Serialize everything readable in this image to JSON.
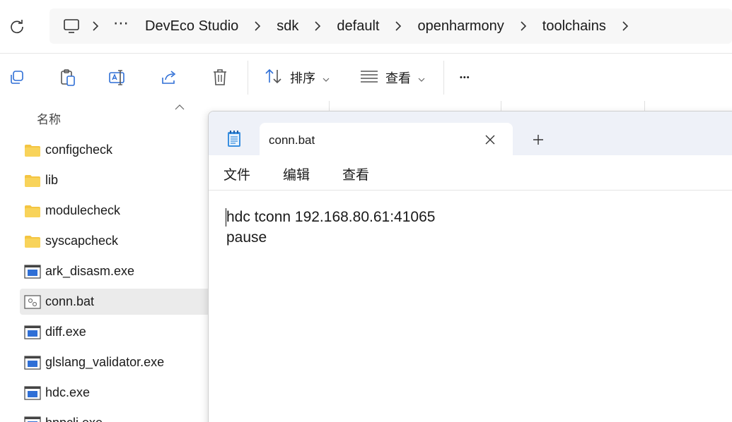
{
  "address_bar": {
    "ellipsis": "⋯",
    "breadcrumbs": [
      "DevEco Studio",
      "sdk",
      "default",
      "openharmony",
      "toolchains"
    ]
  },
  "toolbar": {
    "sort_label": "排序",
    "view_label": "查看",
    "more_label": "•••"
  },
  "file_list": {
    "name_header": "名称",
    "items": [
      {
        "name": "configcheck",
        "type": "folder"
      },
      {
        "name": "lib",
        "type": "folder"
      },
      {
        "name": "modulecheck",
        "type": "folder"
      },
      {
        "name": "syscapcheck",
        "type": "folder"
      },
      {
        "name": "ark_disasm.exe",
        "type": "exe"
      },
      {
        "name": "conn.bat",
        "type": "bat",
        "selected": true
      },
      {
        "name": "diff.exe",
        "type": "exe"
      },
      {
        "name": "glslang_validator.exe",
        "type": "exe"
      },
      {
        "name": "hdc.exe",
        "type": "exe"
      },
      {
        "name": "hnpcli.exe",
        "type": "exe"
      }
    ]
  },
  "notepad": {
    "tab_title": "conn.bat",
    "menu": [
      "文件",
      "编辑",
      "查看"
    ],
    "content_lines": [
      "hdc tconn 192.168.80.61:41065",
      "pause"
    ]
  },
  "colors": {
    "folder": "#f4c542",
    "exe_blue": "#2f6fd6",
    "selected_row": "#ebebeb",
    "notepad_title_bg": "#eef1f8"
  }
}
